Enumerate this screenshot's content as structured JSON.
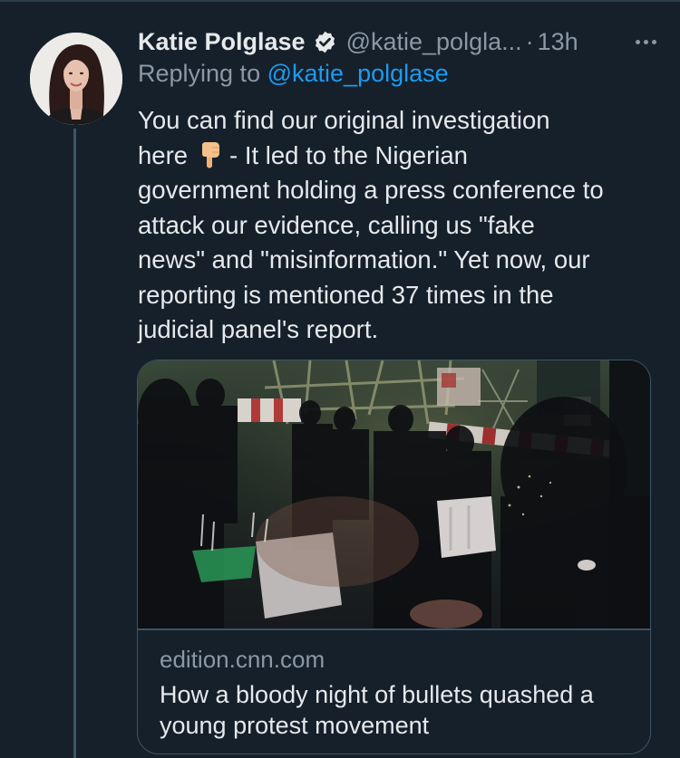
{
  "tweet": {
    "author_name": "Katie Polglase",
    "handle": "@katie_polgla...",
    "separator": "·",
    "time": "13h",
    "replying_prefix": "Replying to",
    "replying_handle": "@katie_polglase",
    "text_lines": [
      "You can find our original investigation",
      "here",
      "- It led to the Nigerian",
      "government holding a press conference to",
      "attack our evidence, calling us \"fake",
      "news\" and \"misinformation.\" Yet now, our",
      "reporting is mentioned 37 times in the",
      "judicial panel's report."
    ]
  },
  "card": {
    "domain": "edition.cnn.com",
    "title": "How a bloody night of bullets quashed a young protest movement"
  },
  "icons": {
    "verified": "verified-badge-icon",
    "more": "more-options-icon",
    "emoji": "backhand-index-pointing-down-emoji"
  },
  "colors": {
    "background": "#15202b",
    "text_primary": "#e7e9ea",
    "text_secondary": "#8b98a5",
    "link": "#1d9bf0",
    "border": "#3d5466"
  }
}
